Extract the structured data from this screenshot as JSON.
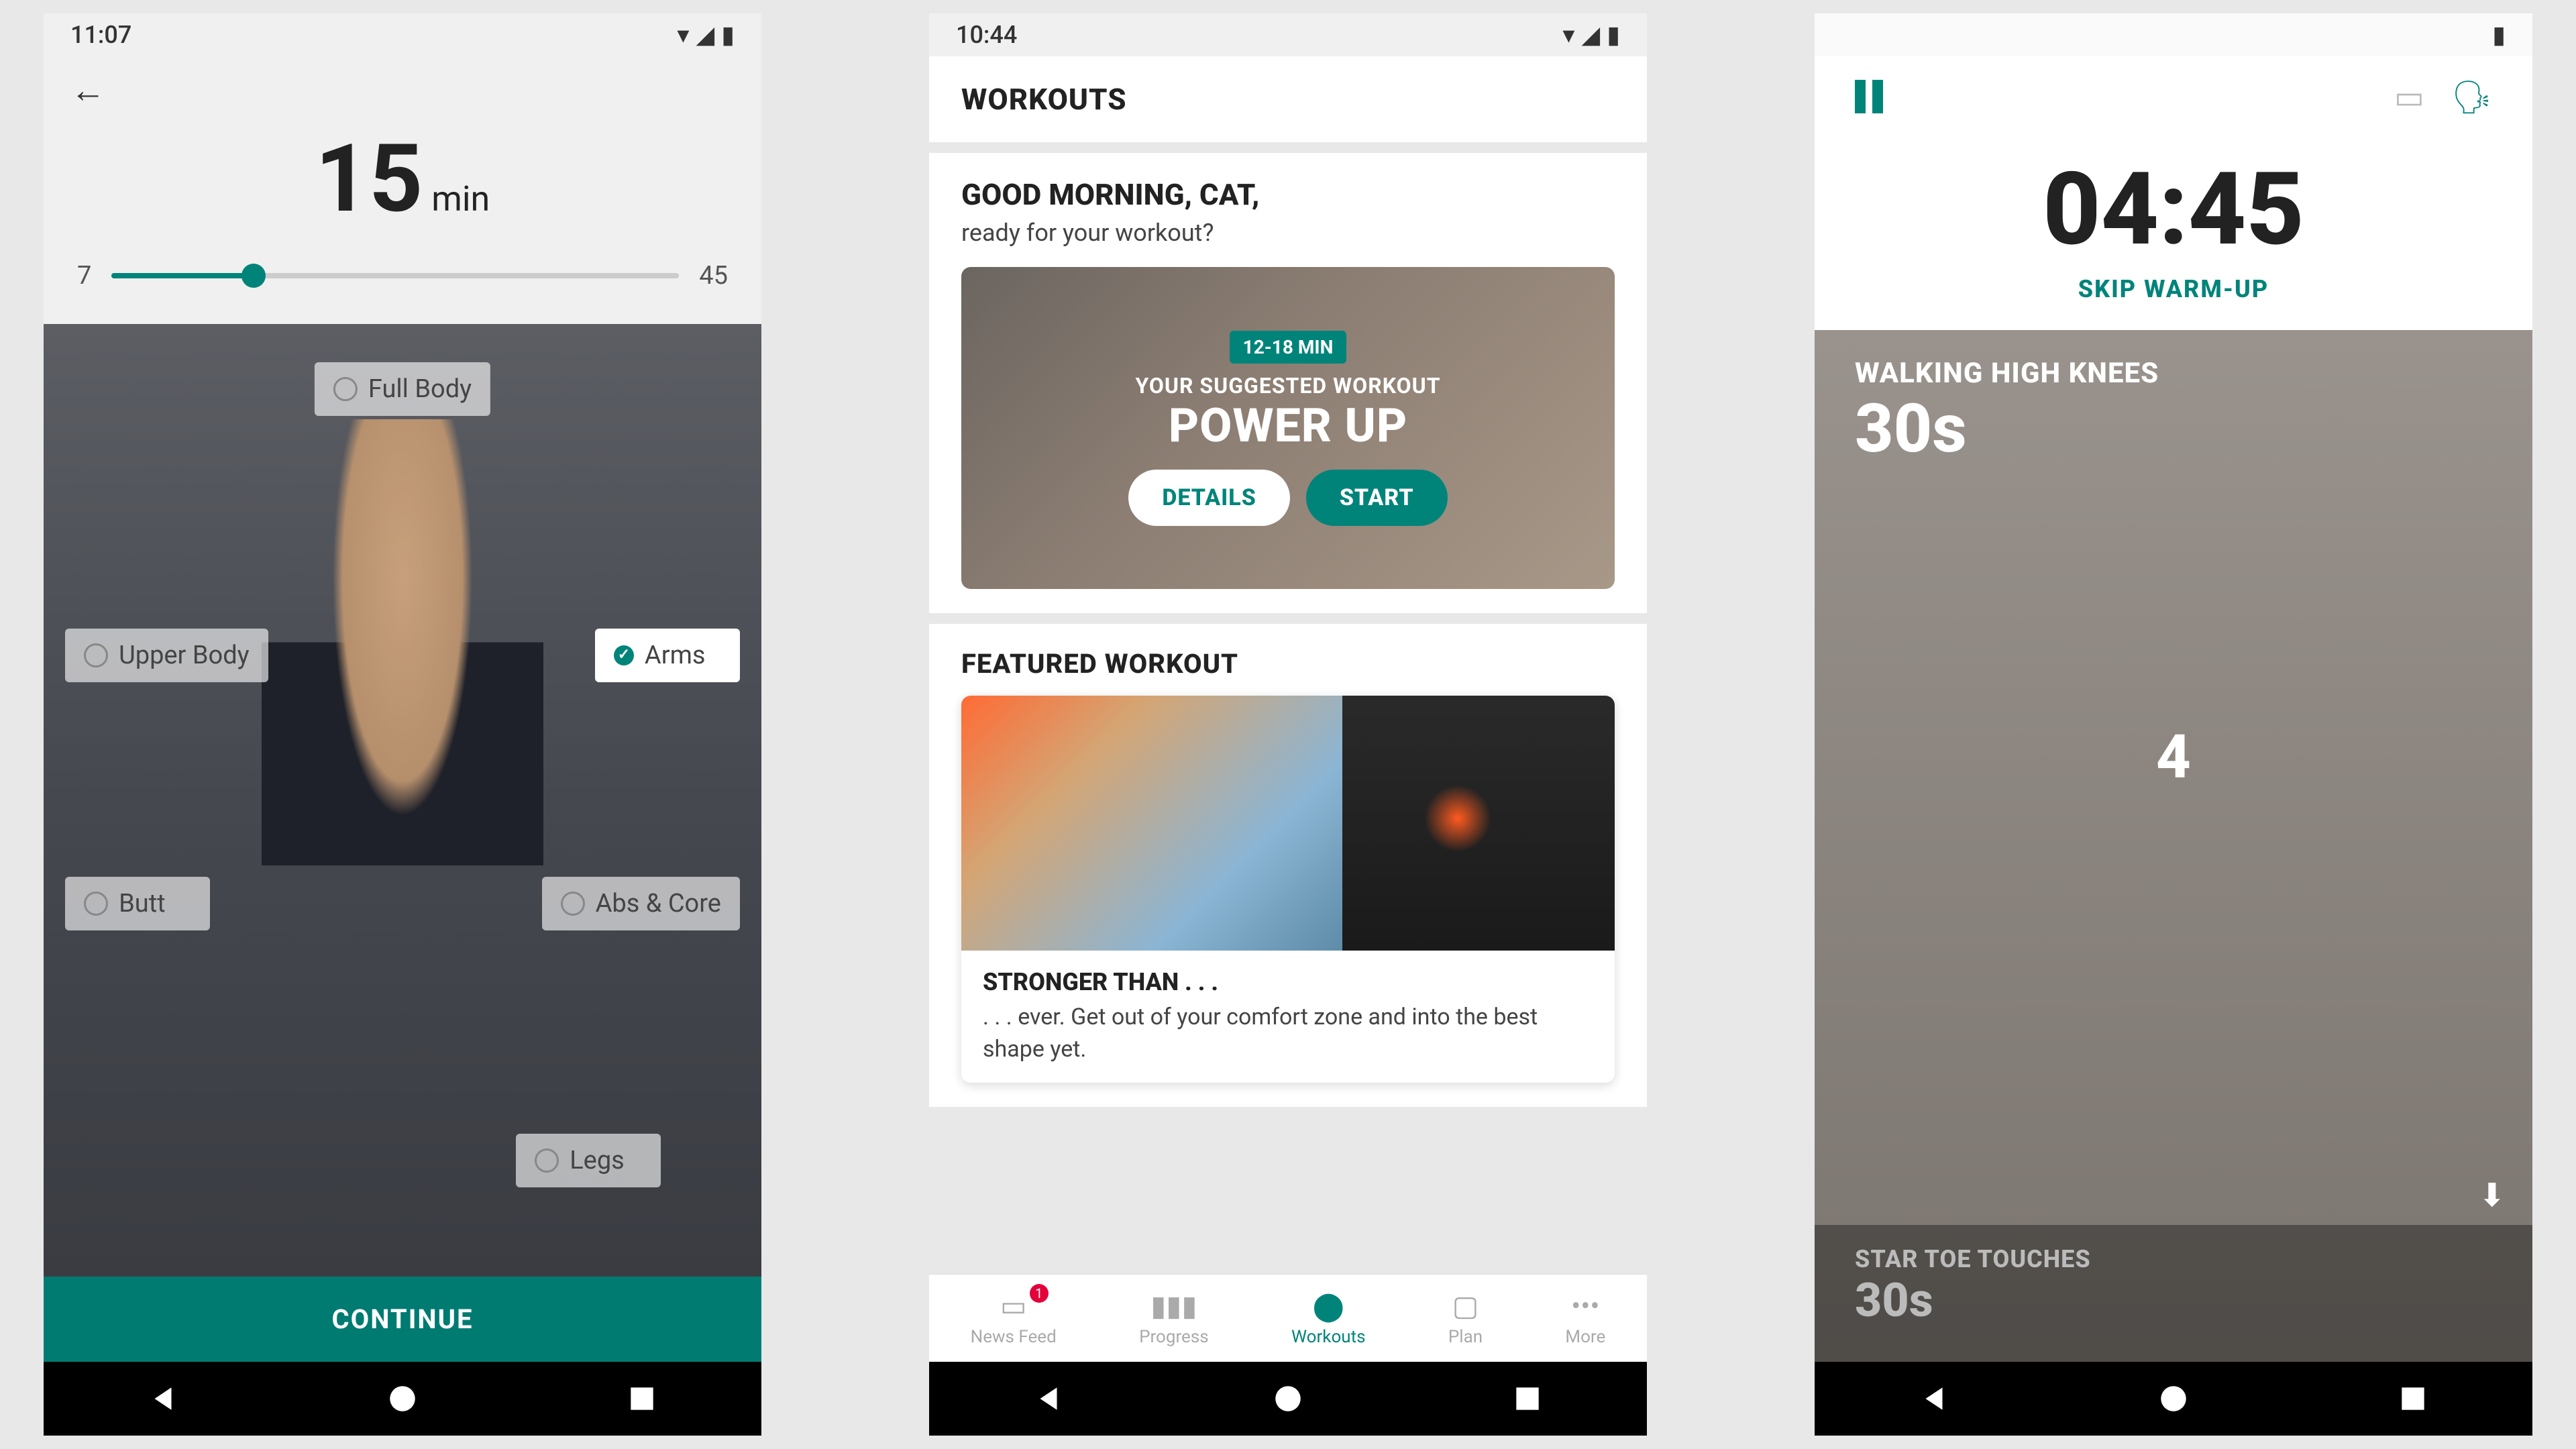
{
  "status": {
    "time1": "11:07",
    "time2": "10:44"
  },
  "colors": {
    "accent": "#00847a",
    "badge_red": "#e4003a"
  },
  "phone1": {
    "duration_value": "15",
    "duration_unit": " min",
    "slider_min": "7",
    "slider_max": "45",
    "body_parts": {
      "full_body": "Full Body",
      "upper_body": "Upper Body",
      "arms": "Arms",
      "butt": "Butt",
      "abs_core": "Abs & Core",
      "legs": "Legs"
    },
    "continue": "CONTINUE"
  },
  "phone2": {
    "title": "WORKOUTS",
    "greeting": "GOOD MORNING, CAT,",
    "subgreeting": "ready for your workout?",
    "hero": {
      "badge": "12-18 MIN",
      "subtitle": "YOUR SUGGESTED WORKOUT",
      "title": "POWER UP",
      "details": "DETAILS",
      "start": "START"
    },
    "featured_label": "FEATURED WORKOUT",
    "featured": {
      "title": "STRONGER THAN . . .",
      "desc": ". . . ever. Get out of your comfort zone and into the best shape yet."
    },
    "tabs": {
      "news": "News Feed",
      "progress": "Progress",
      "workouts": "Workouts",
      "plan": "Plan",
      "more": "More",
      "badge": "1"
    }
  },
  "phone3": {
    "timer": "04:45",
    "skip": "SKIP WARM-UP",
    "exercise": {
      "name": "WALKING HIGH KNEES",
      "duration": "30s",
      "count": "4"
    },
    "next": {
      "name": "STAR TOE TOUCHES",
      "duration": "30s"
    }
  }
}
